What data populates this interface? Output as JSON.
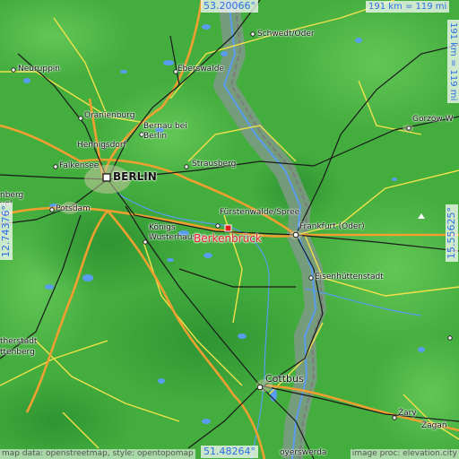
{
  "coordinates": {
    "lat_top": "53.20066°",
    "lat_bottom": "51.48264°",
    "lon_left": "12.74376°",
    "lon_right": "15.55625°"
  },
  "scale": {
    "horizontal": "191 km = 119 mi",
    "vertical": "191 km = 119 mi"
  },
  "highlight_city": "Berkenbrück",
  "capital_label": "BERLIN",
  "cities": {
    "schwedt": "Schwedt/Oder",
    "neuruppin": "Neuruppin",
    "eberswalde": "Eberswalde",
    "oranienburg": "Oranienburg",
    "bernau": "Bernau bei Berlin",
    "hennigsdorf": "Hennigsdorf",
    "falkensee": "Falkensee",
    "strausberg": "Strausberg",
    "gorzow": "Gorzów W",
    "nberg": "nberg",
    "vel": "vel",
    "potsdam": "Potsdam",
    "furstenwalde": "Fürstenwalde/Spree",
    "frankfurt": "Frankfurt (Oder)",
    "konigs_wusterhausen": "Königs Wusterhausen",
    "eisenhuttenstadt": "Eisenhüttenstadt",
    "therstadt": "therstadt",
    "ttenberg": "ttenberg",
    "cottbus": "Cottbus",
    "zary": "Żary",
    "zagan": "Żagań",
    "hoyerswerda": "oyerswerda"
  },
  "footer": {
    "left": "map data: openstreetmap, style: opentopomap",
    "right": "image proc: elevation.city"
  },
  "colors": {
    "lowland": "#43ad3e",
    "valley": "#7e9a86",
    "road_major": "#f0a030",
    "road_secondary": "#f2e24a",
    "rail": "#1a1a1a",
    "water": "#5a9cf0",
    "border": "#7c7c7c",
    "highlight": "#e02020",
    "coord_text": "#2d6ee6"
  }
}
